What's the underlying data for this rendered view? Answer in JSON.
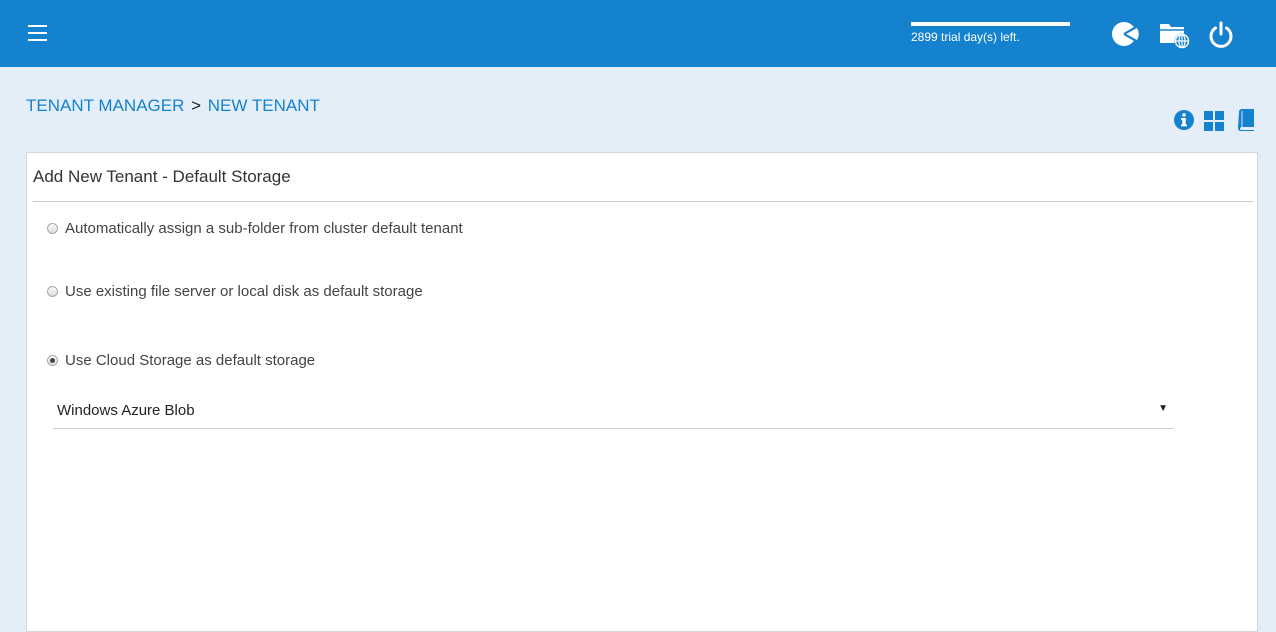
{
  "header": {
    "menu_icon": "hamburger-menu-icon",
    "trial": {
      "text": "2899 trial day(s) left.",
      "progress": 1.0
    },
    "icons": [
      "dashboard-pie-icon",
      "folder-globe-icon",
      "power-icon"
    ]
  },
  "breadcrumb": {
    "parent": "TENANT MANAGER",
    "separator": ">",
    "current": "NEW TENANT"
  },
  "toolbar": {
    "icons": [
      "info-icon",
      "grid-view-icon",
      "book-icon"
    ]
  },
  "panel": {
    "title": "Add New Tenant - Default Storage",
    "options": [
      {
        "label": "Automatically assign a sub-folder from cluster default tenant",
        "checked": false
      },
      {
        "label": "Use existing file server or local disk as default storage",
        "checked": false
      },
      {
        "label": "Use Cloud Storage as default storage",
        "checked": true
      }
    ],
    "storage_select": {
      "value": "Windows Azure Blob",
      "arrow": "▼"
    }
  },
  "colors": {
    "brand": "#1582d0",
    "background": "#e3eef8"
  }
}
